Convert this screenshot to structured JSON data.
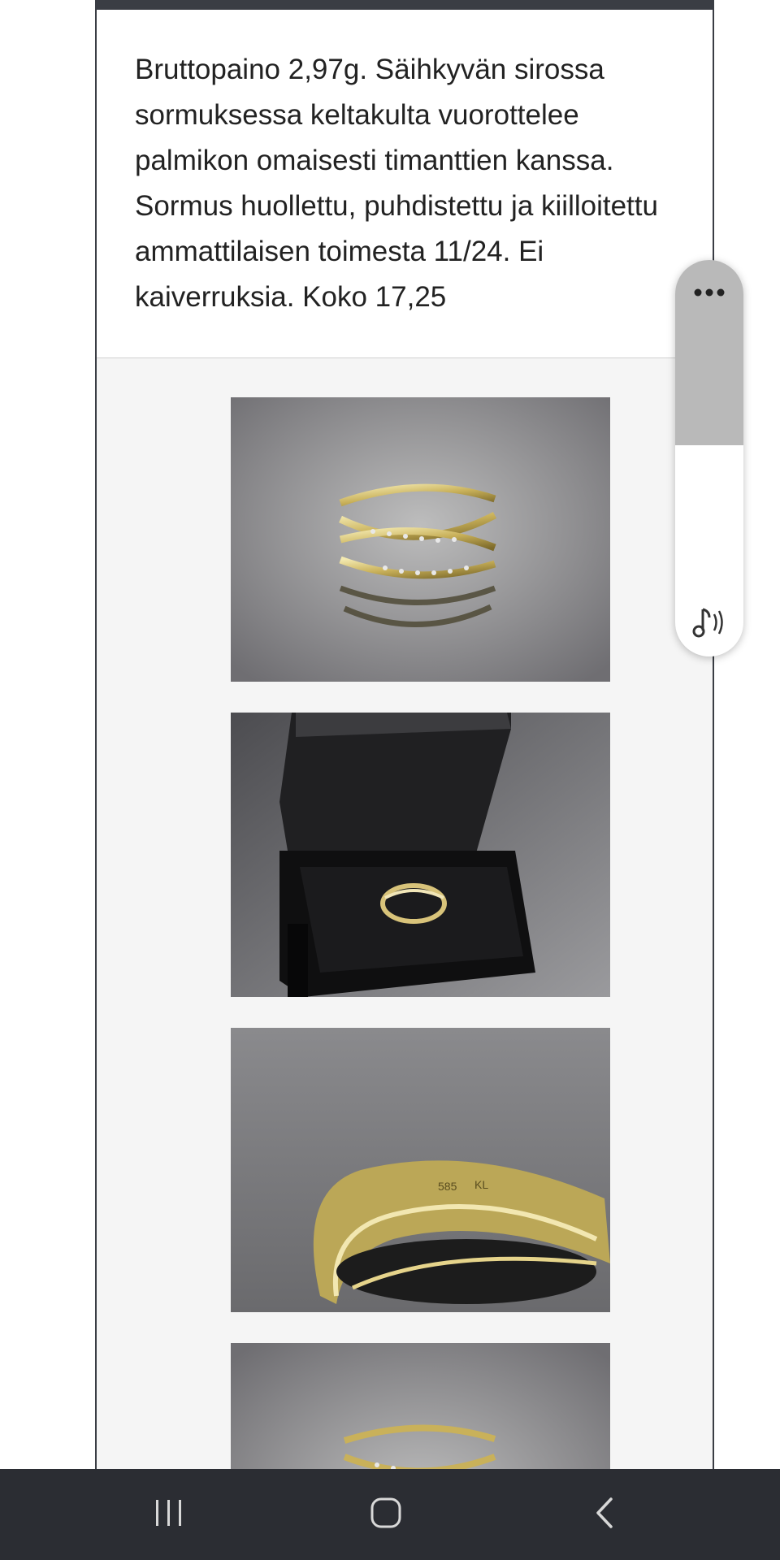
{
  "product": {
    "description": "Bruttopaino 2,97g. Säihkyvän sirossa sormuksessa keltakulta vuorottelee palmikon omaisesti timanttien kanssa. Sormus huollettu, puhdistettu ja kiilloitettu ammattilaisen toimesta 11/24. Ei kaiverruksia. Koko 17,25"
  },
  "gallery": {
    "images": [
      {
        "icon": "ring-front-photo"
      },
      {
        "icon": "ring-in-box-photo"
      },
      {
        "icon": "ring-inside-hallmark-photo"
      },
      {
        "icon": "ring-front-photo-partial"
      }
    ]
  },
  "reader_widget": {
    "icons": [
      "more-icon",
      "read-aloud-icon"
    ],
    "colors": {
      "top": "#b9b9b9",
      "bottom": "#ffffff"
    }
  },
  "navbar": {
    "buttons": [
      "recent-apps-icon",
      "home-icon",
      "back-icon"
    ],
    "background": "#2b2d33"
  }
}
